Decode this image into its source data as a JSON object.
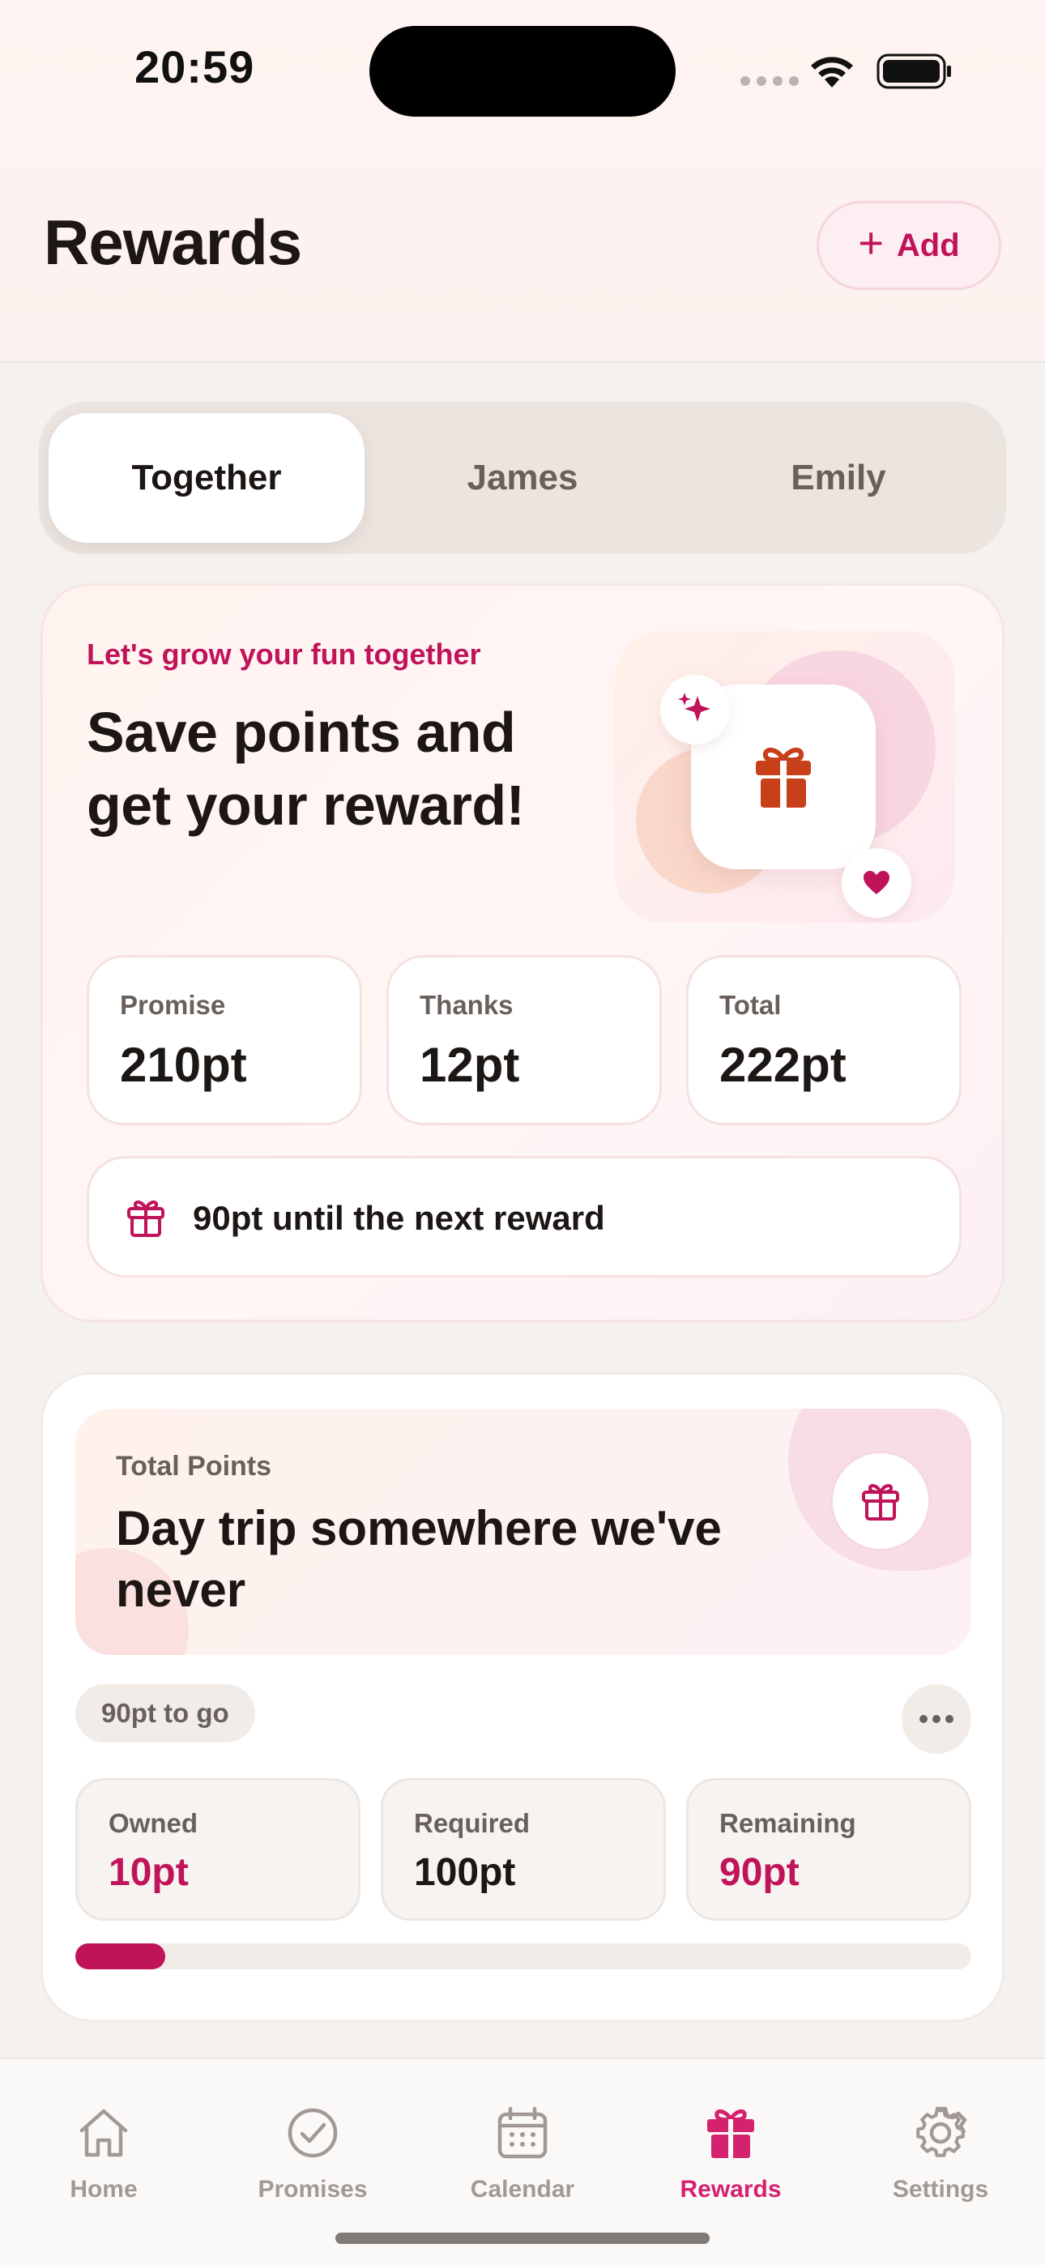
{
  "status_bar": {
    "time": "20:59"
  },
  "header": {
    "title": "Rewards",
    "add_label": "Add"
  },
  "segments": [
    {
      "label": "Together",
      "active": true
    },
    {
      "label": "James",
      "active": false
    },
    {
      "label": "Emily",
      "active": false
    }
  ],
  "hero": {
    "eyebrow": "Let's grow your fun together",
    "title_line1": "Save points and",
    "title_line2": "get your reward!",
    "stats": [
      {
        "label": "Promise",
        "value": "210pt"
      },
      {
        "label": "Thanks",
        "value": "12pt"
      },
      {
        "label": "Total",
        "value": "222pt"
      }
    ],
    "next_reward_text": "90pt until the next reward"
  },
  "goal": {
    "eyebrow": "Total Points",
    "title": "Day trip somewhere we've never",
    "to_go": "90pt to go",
    "stats": [
      {
        "label": "Owned",
        "value": "10pt"
      },
      {
        "label": "Required",
        "value": "100pt"
      },
      {
        "label": "Remaining",
        "value": "90pt"
      }
    ],
    "progress_fraction": 0.1
  },
  "tabbar": [
    {
      "label": "Home",
      "icon": "home-icon",
      "active": false
    },
    {
      "label": "Promises",
      "icon": "check-circle-icon",
      "active": false
    },
    {
      "label": "Calendar",
      "icon": "calendar-icon",
      "active": false
    },
    {
      "label": "Rewards",
      "icon": "gift-icon",
      "active": true
    },
    {
      "label": "Settings",
      "icon": "gear-icon",
      "active": false
    }
  ],
  "colors": {
    "accent": "#c0135a",
    "accent_tab": "#d4226f",
    "gift_orange": "#c8401a",
    "muted_text": "#6a605b",
    "background": "#f4f1ee"
  }
}
